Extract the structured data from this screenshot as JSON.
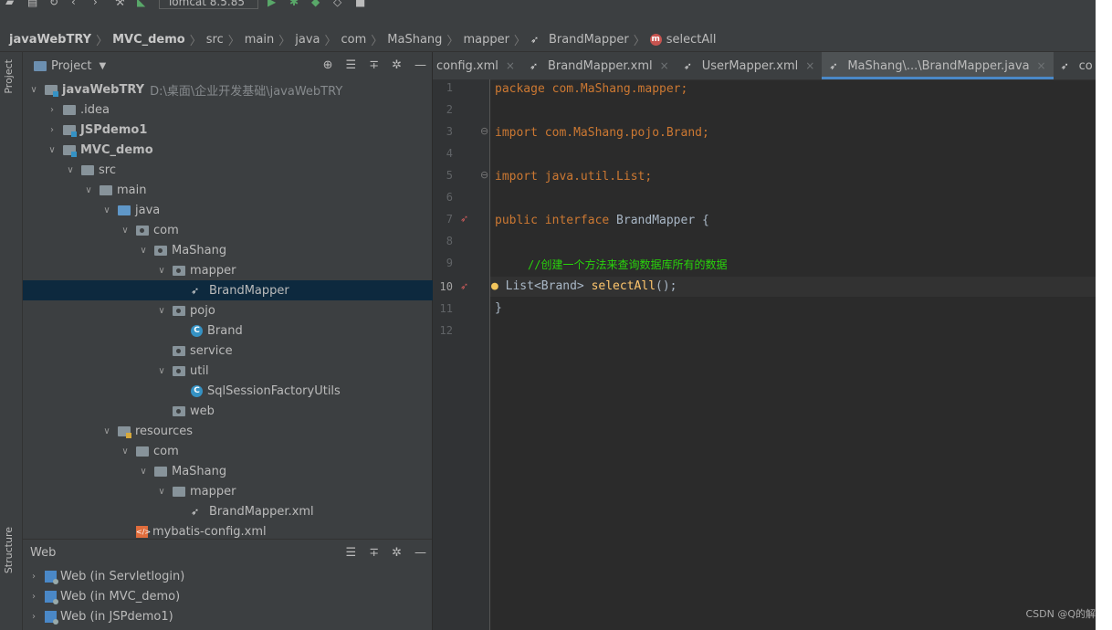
{
  "toolbar": {
    "run_config": "Tomcat 8.5.85"
  },
  "breadcrumb": {
    "items": [
      "javaWebTRY",
      "MVC_demo",
      "src",
      "main",
      "java",
      "com",
      "MaShang",
      "mapper",
      "BrandMapper",
      "selectAll"
    ]
  },
  "left_stripe": {
    "project": "Project",
    "structure": "Structure"
  },
  "project_panel": {
    "title": "Project",
    "tree": [
      {
        "label": "javaWebTRY",
        "path": "D:\\桌面\\企业开发基础\\javaWebTRY"
      },
      {
        "label": ".idea"
      },
      {
        "label": "JSPdemo1"
      },
      {
        "label": "MVC_demo"
      },
      {
        "label": "src"
      },
      {
        "label": "main"
      },
      {
        "label": "java"
      },
      {
        "label": "com"
      },
      {
        "label": "MaShang"
      },
      {
        "label": "mapper"
      },
      {
        "label": "BrandMapper"
      },
      {
        "label": "pojo"
      },
      {
        "label": "Brand"
      },
      {
        "label": "service"
      },
      {
        "label": "util"
      },
      {
        "label": "SqlSessionFactoryUtils"
      },
      {
        "label": "web"
      },
      {
        "label": "resources"
      },
      {
        "label": "com"
      },
      {
        "label": "MaShang"
      },
      {
        "label": "mapper"
      },
      {
        "label": "BrandMapper.xml"
      },
      {
        "label": "mybatis-config.xml"
      }
    ]
  },
  "web_panel": {
    "title": "Web",
    "items": [
      "Web (in Servletlogin)",
      "Web (in MVC_demo)",
      "Web (in JSPdemo1)"
    ]
  },
  "editor": {
    "tabs": [
      {
        "label": "config.xml"
      },
      {
        "label": "BrandMapper.xml"
      },
      {
        "label": "UserMapper.xml"
      },
      {
        "label": "MaShang\\...\\BrandMapper.java",
        "active": true
      },
      {
        "label": "co"
      }
    ],
    "line_numbers": [
      "1",
      "2",
      "3",
      "4",
      "5",
      "6",
      "7",
      "8",
      "9",
      "10",
      "11",
      "12"
    ],
    "code": {
      "l1_kw": "package",
      "l1_rest": " com.MaShang.mapper;",
      "l3_kw": "import",
      "l3_rest": " com.MaShang.pojo.Brand;",
      "l5_kw": "import",
      "l5_rest": " java.util.List;",
      "l7_kw": "public interface",
      "l7_rest": " BrandMapper {",
      "l9_comment": "//创建一个方法来查询数据库所有的数据",
      "l10_type": "List<Brand> ",
      "l10_fn": "selectAll",
      "l10_rest": "();",
      "l11": "}"
    }
  },
  "watermark": "CSDN @Q的解"
}
